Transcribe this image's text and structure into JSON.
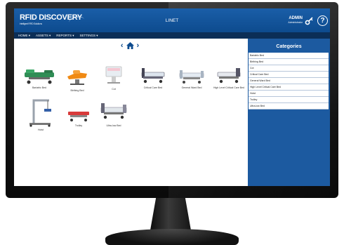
{
  "header": {
    "logo_text": "RFID DISCOVERY",
    "logo_sub": "Intelligent RFID Solutions",
    "app_title": "LINET",
    "user_name": "ADMIN",
    "user_role": "Administrator",
    "help_glyph": "?"
  },
  "nav": {
    "items": [
      "HOME ▾",
      "ASSETS ▾",
      "REPORTS ▾",
      "SETTINGS ▾"
    ]
  },
  "pager": {
    "prev": "‹",
    "next": "›"
  },
  "products": [
    {
      "label": "Bariatric Bed"
    },
    {
      "label": "Birthing Bed"
    },
    {
      "label": "Cot"
    },
    {
      "label": "Critical Care Bed"
    },
    {
      "label": "General Ward Bed"
    },
    {
      "label": "High Level Critical Care Bed"
    },
    {
      "label": "Hoist"
    },
    {
      "label": "Trolley"
    },
    {
      "label": "Ultra-low Bed"
    }
  ],
  "sidebar": {
    "title": "Categories",
    "items": [
      "Bariatric Bed",
      "Birthing Bed",
      "Cot",
      "Critical Care Bed",
      "General Ward Bed",
      "High Level Critical Care Bed",
      "Hoist",
      "Trolley",
      "Ultra-low Bed"
    ]
  },
  "colors": {
    "brand": "#1c5aa0",
    "header": "#0d4b8e",
    "nav": "#0b2e57"
  }
}
